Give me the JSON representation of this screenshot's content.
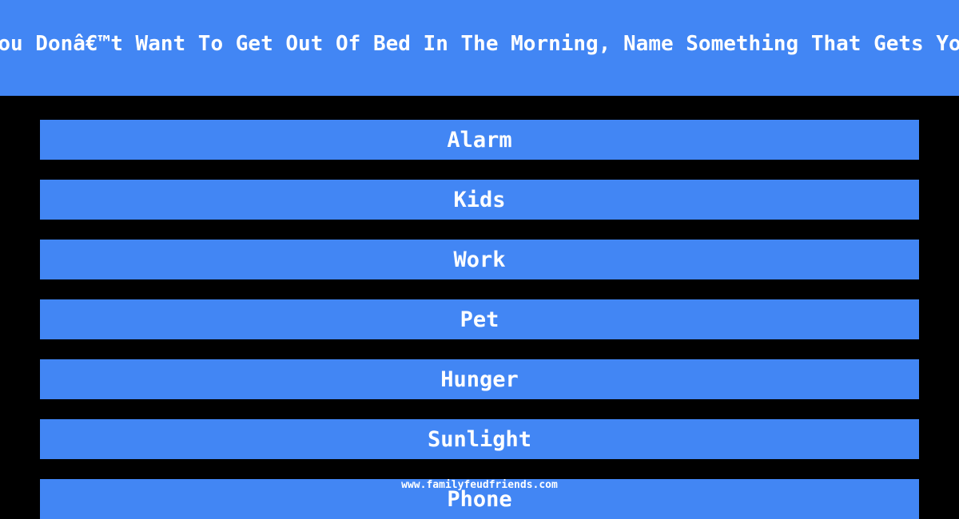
{
  "header": {
    "question": "If You Donâ€™t Want To Get Out Of Bed In The Morning, Name Something That Gets You Up",
    "background": "#4286f4"
  },
  "answers": [
    {
      "label": "Alarm"
    },
    {
      "label": "Kids"
    },
    {
      "label": "Work"
    },
    {
      "label": "Pet"
    },
    {
      "label": "Hunger"
    },
    {
      "label": "Sunlight"
    },
    {
      "label": "Phone"
    }
  ],
  "footer": {
    "watermark": "www.familyfeudfriends.com"
  },
  "colors": {
    "accent": "#4286f4",
    "background": "#000000",
    "text": "#ffffff"
  }
}
